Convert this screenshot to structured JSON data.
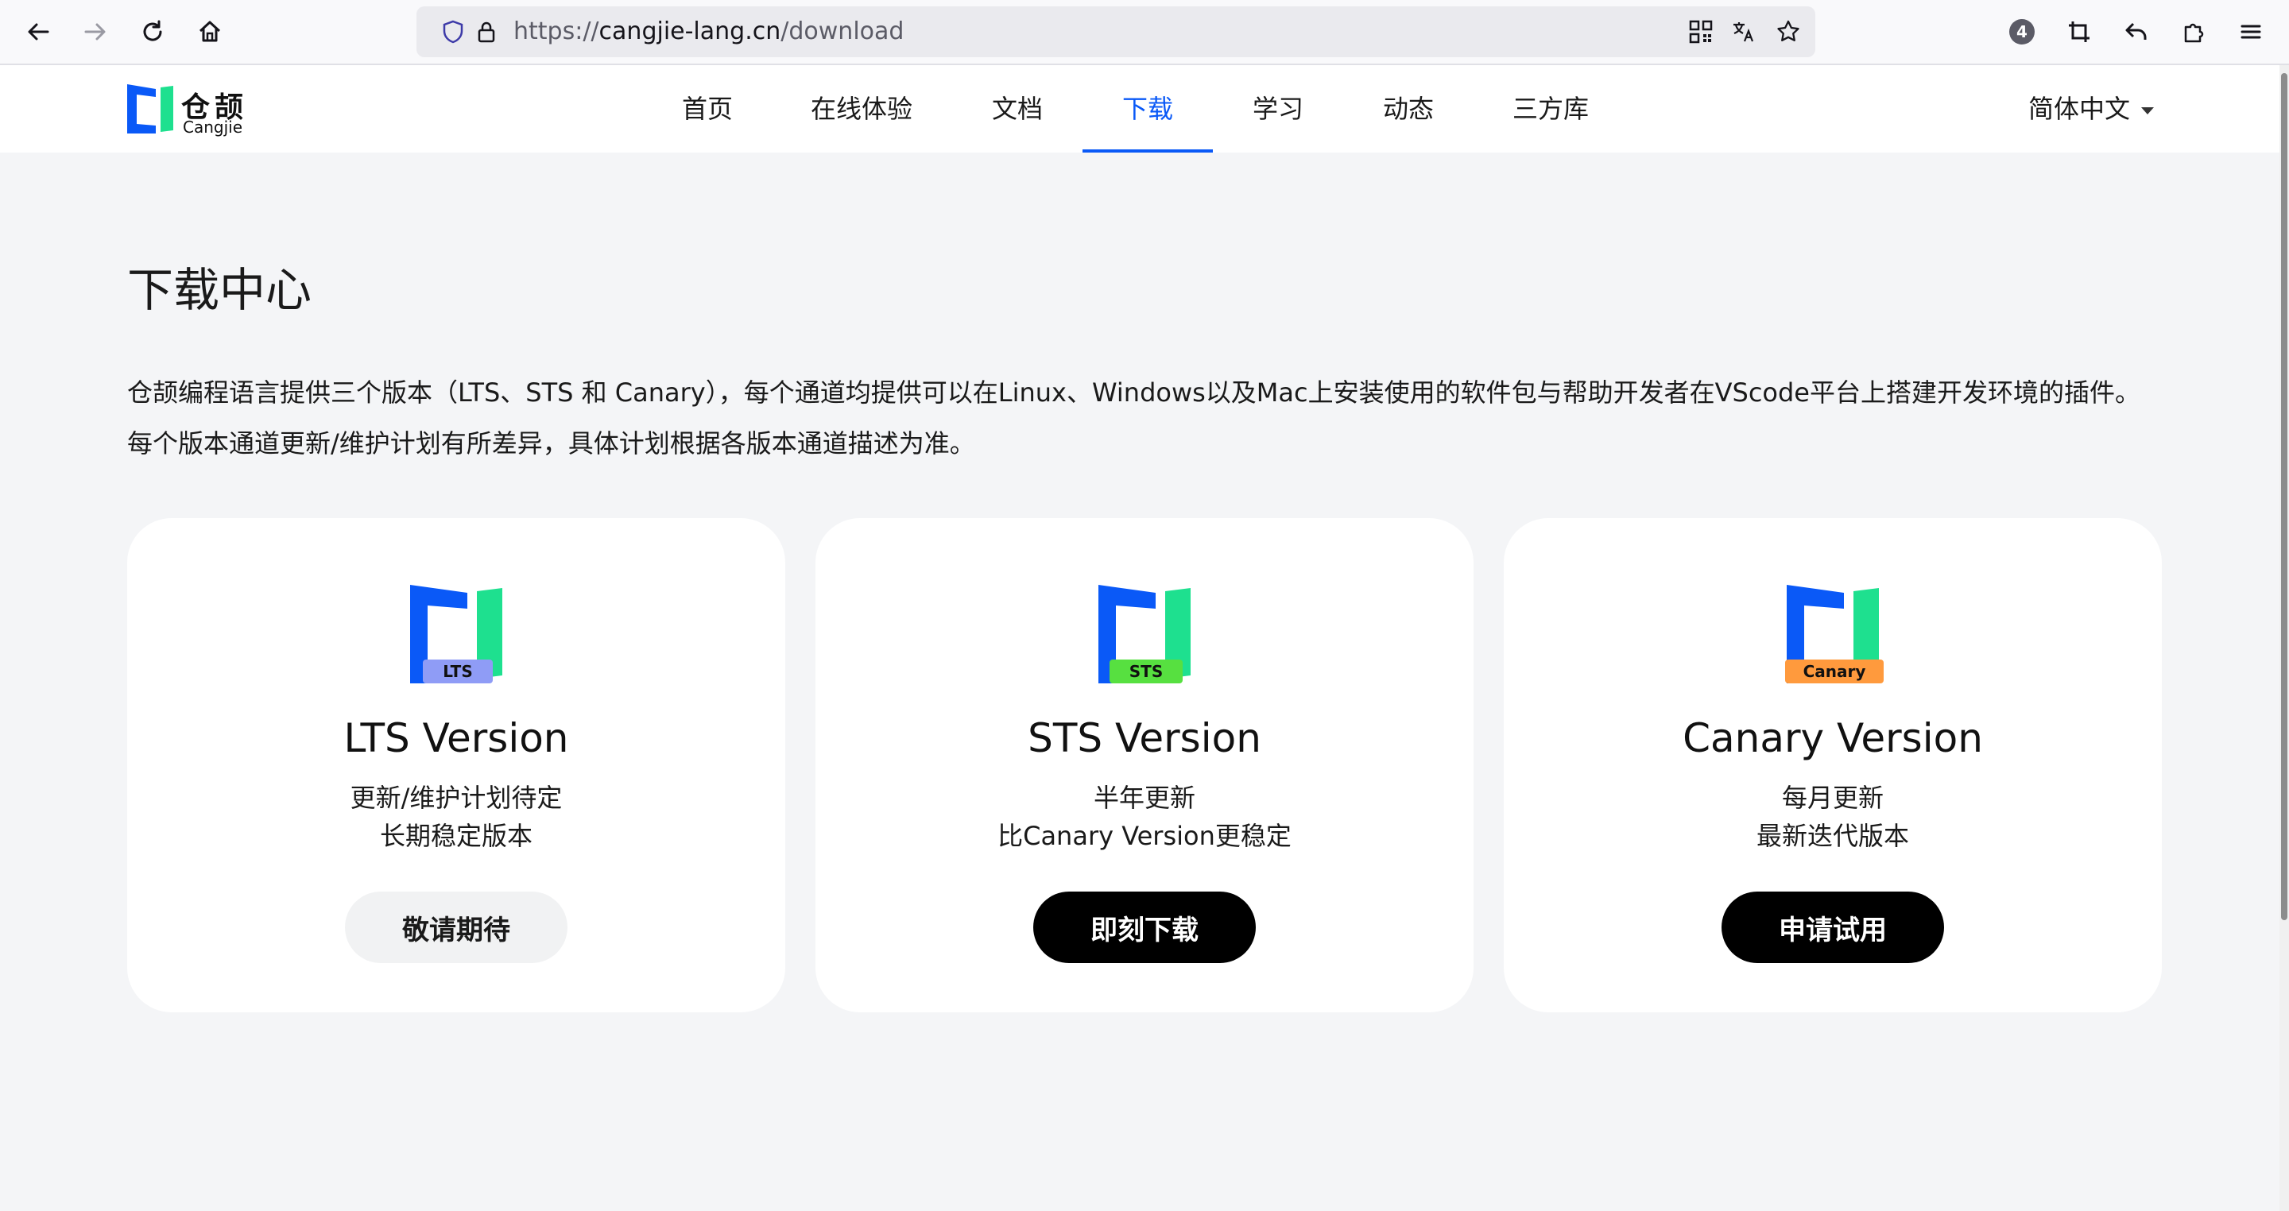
{
  "browser": {
    "url_prefix": "https://",
    "url_host": "cangjie-lang.cn",
    "url_path": "/download",
    "extensions_badge": "4"
  },
  "header": {
    "logo_cn": "仓颉",
    "logo_en": "Cangjie",
    "nav": [
      "首页",
      "在线体验",
      "文档",
      "下载",
      "学习",
      "动态",
      "三方库"
    ],
    "active_index": 3,
    "language": "简体中文"
  },
  "main": {
    "title": "下载中心",
    "intro": "仓颉编程语言提供三个版本（LTS、STS 和 Canary），每个通道均提供可以在Linux、Windows以及Mac上安装使用的软件包与帮助开发者在VScode平台上搭建开发环境的插件。每个版本通道更新/维护计划有所差异，具体计划根据各版本通道描述为准。",
    "cards": [
      {
        "tag": "LTS",
        "title": "LTS Version",
        "desc1": "更新/维护计划待定",
        "desc2": "长期稳定版本",
        "button": "敬请期待"
      },
      {
        "tag": "STS",
        "title": "STS Version",
        "desc1": "半年更新",
        "desc2": "比Canary Version更稳定",
        "button": "即刻下载"
      },
      {
        "tag": "Canary",
        "title": "Canary Version",
        "desc1": "每月更新",
        "desc2": "最新迭代版本",
        "button": "申请试用"
      }
    ]
  },
  "colors": {
    "accent": "#0a59f7",
    "logo_blue": "#0a59f7",
    "logo_green": "#1ee08f",
    "tag_lts": "#8f9cf6",
    "tag_sts": "#57e040",
    "tag_canary": "#ff9a3d"
  }
}
